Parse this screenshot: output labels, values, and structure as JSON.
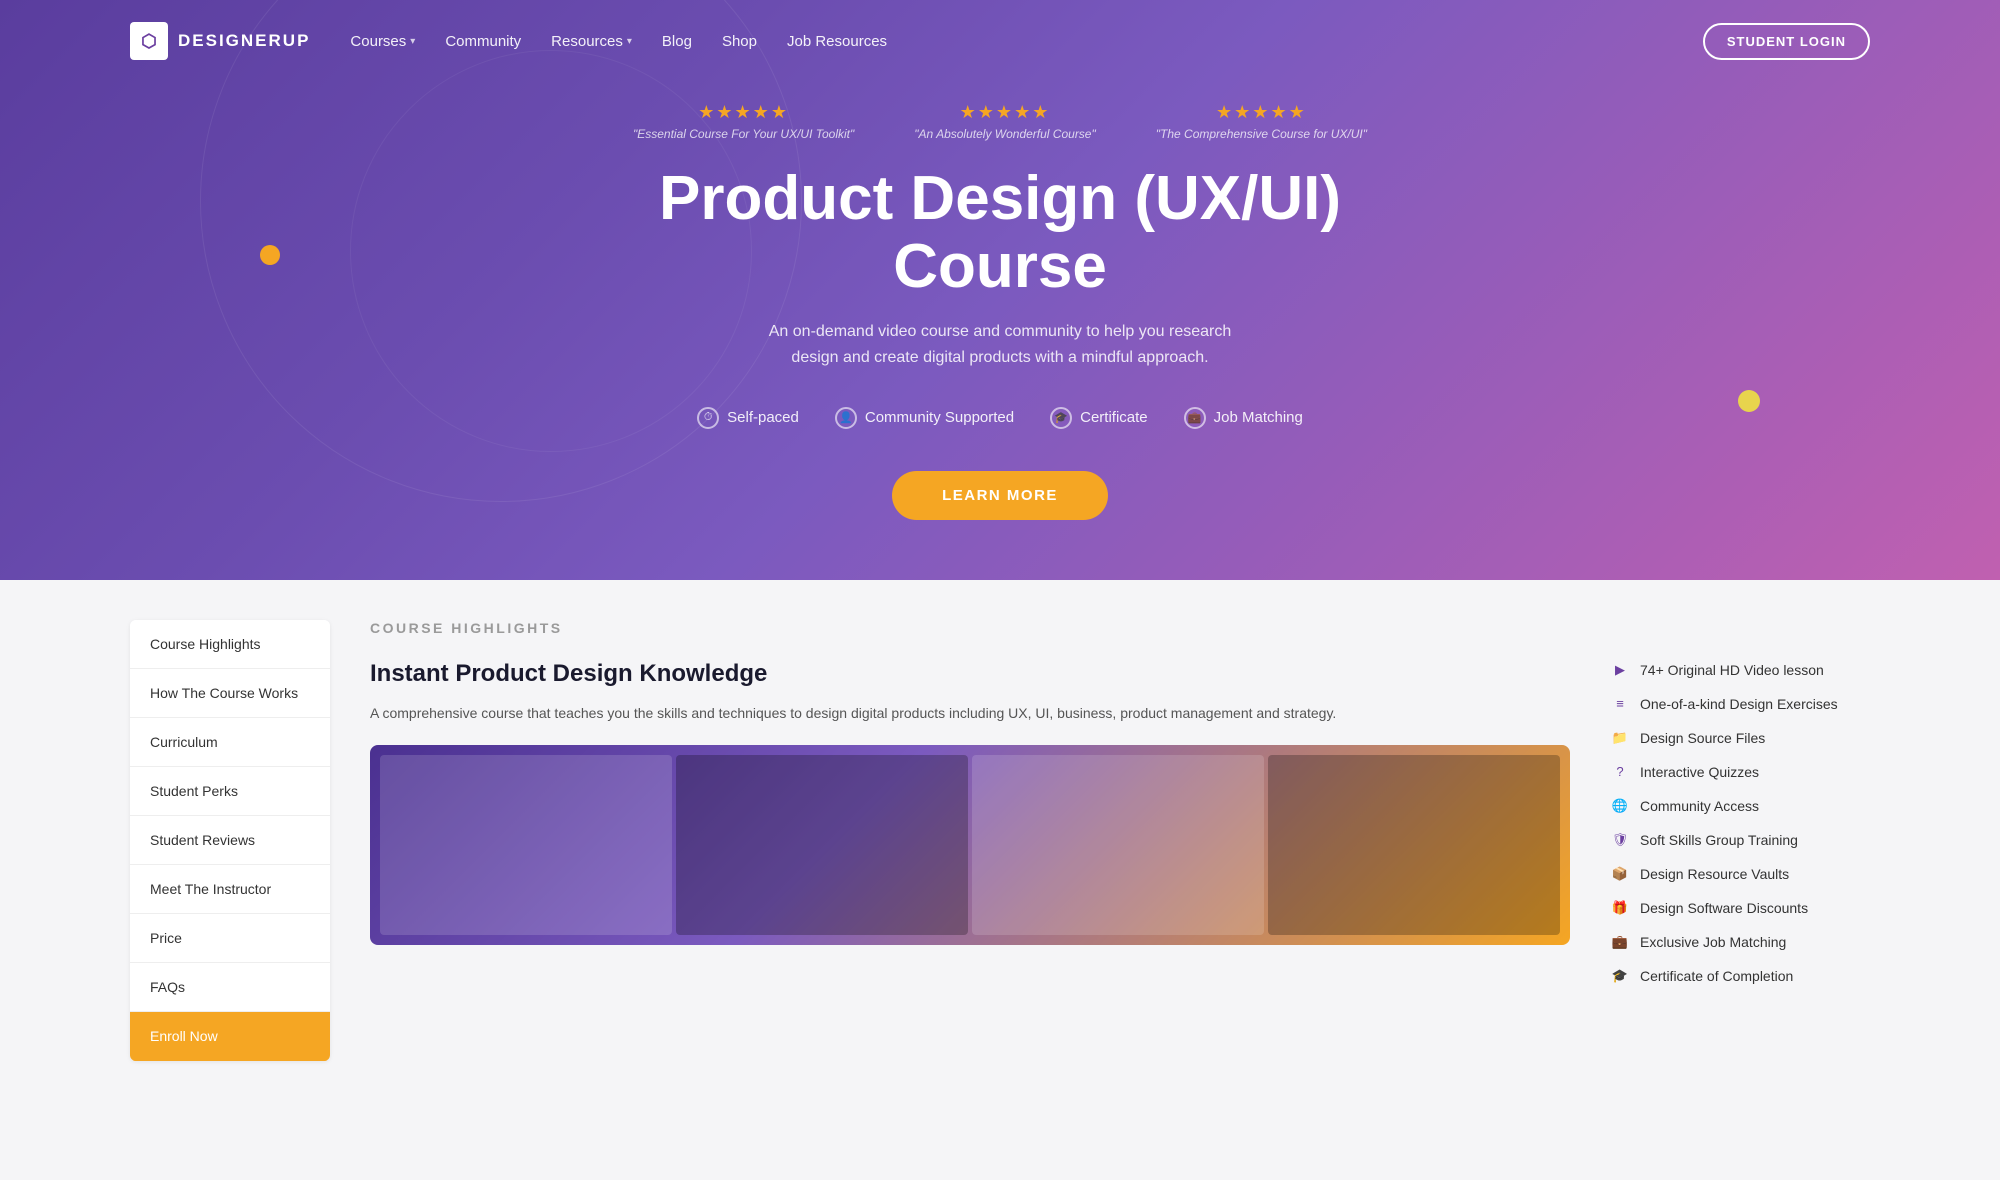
{
  "nav": {
    "logo_text": "DESIGNERUP",
    "links": [
      {
        "label": "Courses",
        "has_dropdown": true
      },
      {
        "label": "Community",
        "has_dropdown": false
      },
      {
        "label": "Resources",
        "has_dropdown": true
      },
      {
        "label": "Blog",
        "has_dropdown": false
      },
      {
        "label": "Shop",
        "has_dropdown": false
      },
      {
        "label": "Job Resources",
        "has_dropdown": false
      }
    ],
    "login_button": "STUDENT LOGIN"
  },
  "hero": {
    "stars": [
      {
        "quote": "\"Essential Course For Your UX/UI Toolkit\""
      },
      {
        "quote": "\"An Absolutely Wonderful Course\""
      },
      {
        "quote": "\"The Comprehensive Course for UX/UI\""
      }
    ],
    "title": "Product Design (UX/UI) Course",
    "subtitle": "An on-demand video course and community to help you research design and create digital products with a mindful approach.",
    "features": [
      {
        "label": "Self-paced",
        "icon": "⏱"
      },
      {
        "label": "Community Supported",
        "icon": "👤"
      },
      {
        "label": "Certificate",
        "icon": "🎓"
      },
      {
        "label": "Job Matching",
        "icon": "💼"
      }
    ],
    "cta_button": "LEARN MORE"
  },
  "sidebar": {
    "items": [
      {
        "label": "Course Highlights",
        "active": false
      },
      {
        "label": "How The Course Works",
        "active": false
      },
      {
        "label": "Curriculum",
        "active": false
      },
      {
        "label": "Student Perks",
        "active": false
      },
      {
        "label": "Student Reviews",
        "active": false
      },
      {
        "label": "Meet The Instructor",
        "active": false
      },
      {
        "label": "Price",
        "active": false
      },
      {
        "label": "FAQs",
        "active": false
      },
      {
        "label": "Enroll Now",
        "active": true
      }
    ]
  },
  "course_highlights": {
    "section_label": "COURSE HIGHLIGHTS",
    "course_title": "Instant Product Design Knowledge",
    "course_description": "A comprehensive course that teaches you the skills and techniques to design digital products including UX, UI, business, product management and strategy.",
    "features": [
      {
        "label": "74+ Original HD Video lesson",
        "icon": "▶"
      },
      {
        "label": "One-of-a-kind Design Exercises",
        "icon": "≡"
      },
      {
        "label": "Design Source Files",
        "icon": "📁"
      },
      {
        "label": "Interactive Quizzes",
        "icon": "?"
      },
      {
        "label": "Community Access",
        "icon": "🌐"
      },
      {
        "label": "Soft Skills Group Training",
        "icon": "🛡"
      },
      {
        "label": "Design Resource Vaults",
        "icon": "📦"
      },
      {
        "label": "Design Software Discounts",
        "icon": "🎁"
      },
      {
        "label": "Exclusive Job Matching",
        "icon": "💼"
      },
      {
        "label": "Certificate of Completion",
        "icon": "🎓"
      }
    ]
  }
}
